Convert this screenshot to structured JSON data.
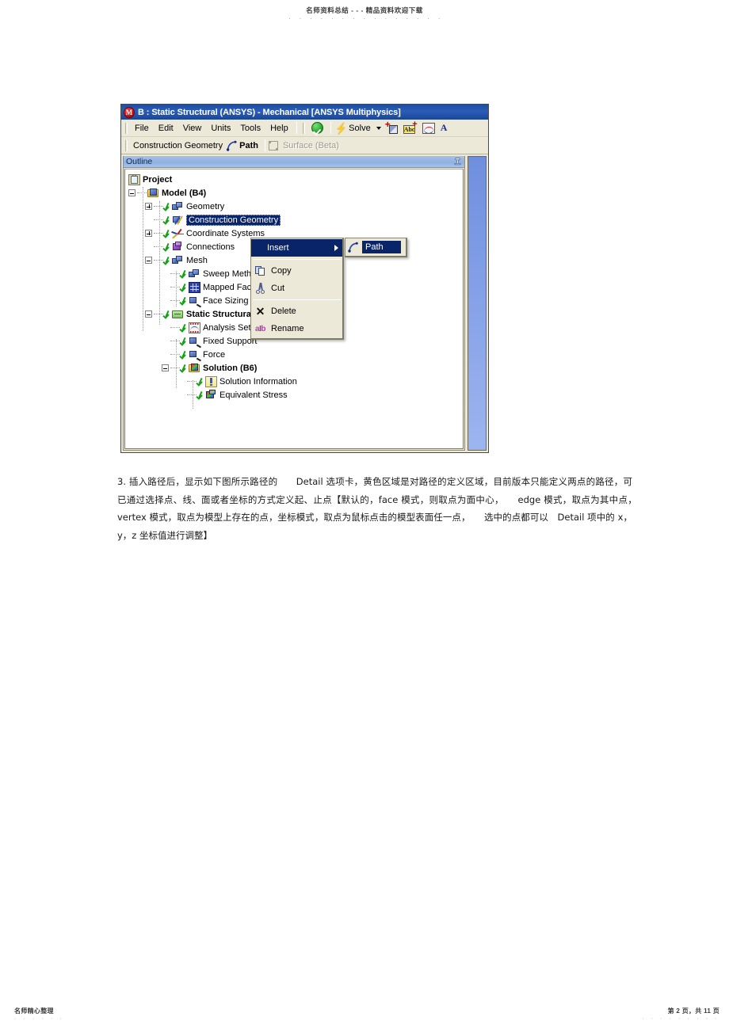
{
  "document": {
    "watermark_header": "名师资料总结 - - - 精品资料欢迎下载",
    "watermark_dots": "· · · · · · · · · · · · · · ·",
    "footer_left": "名师精心整理",
    "footer_left_dots": "· · · · · ·",
    "footer_right": "第 2 页，共 11 页",
    "footer_right_dots": "· · · · · · · · ·",
    "paragraph": "3. 插入路径后，显示如下图所示路径的　　Detail 选项卡，黄色区域是对路径的定义区域，目前版本只能定义两点的路径，可已通过选择点、线、面或者坐标的方式定义起、止点【默认的，face 模式，则取点为面中心，　　edge 模式，取点为其中点，　vertex 模式，取点为模型上存在的点，坐标模式，取点为鼠标点击的模型表面任一点，　　选中的点都可以　Detail 项中的 x，y，z 坐标值进行调整】"
  },
  "app": {
    "window_icon": "mechanical-logo-icon",
    "title": "B : Static Structural (ANSYS) - Mechanical [ANSYS Multiphysics]",
    "menus": [
      "File",
      "Edit",
      "View",
      "Units",
      "Tools",
      "Help"
    ],
    "toolbar": {
      "validate_icon": "green-check-icon",
      "solve_label": "Solve",
      "solve_icon": "lightning-bolt-icon",
      "solve_dropdown_icon": "chevron-down-icon",
      "icons": [
        "new-chart-icon",
        "new-annotation-icon",
        "new-graph-icon",
        "new-text-icon"
      ]
    },
    "toolbar2": {
      "construction_geometry_label": "Construction Geometry",
      "path_label": "Path",
      "path_icon": "path-curve-icon",
      "surface_label": "Surface (Beta)",
      "surface_icon": "surface-square-icon",
      "surface_disabled": true
    }
  },
  "outline": {
    "header_label": "Outline",
    "pin_icon": "pin-icon",
    "tree": [
      {
        "label": "Project",
        "icon": "project-icon",
        "bold": true,
        "indent": 0,
        "expander": "none",
        "check": false
      },
      {
        "label": "Model (B4)",
        "icon": "model-folder-icon",
        "bold": true,
        "indent": 1,
        "expander": "minus",
        "check": false
      },
      {
        "label": "Geometry",
        "icon": "geometry-icon",
        "bold": false,
        "indent": 2,
        "expander": "plus",
        "check": true
      },
      {
        "label": "Construction Geometry",
        "icon": "construction-geometry-icon",
        "bold": false,
        "indent": 2,
        "expander": "none",
        "check": true,
        "selected": true
      },
      {
        "label": "Coordinate Systems",
        "icon": "coordinate-systems-icon",
        "bold": false,
        "indent": 2,
        "expander": "plus",
        "check": true
      },
      {
        "label": "Connections",
        "icon": "connections-icon",
        "bold": false,
        "indent": 2,
        "expander": "none",
        "check": true
      },
      {
        "label": "Mesh",
        "icon": "mesh-icon",
        "bold": false,
        "indent": 2,
        "expander": "minus",
        "check": true
      },
      {
        "label": "Sweep Method",
        "icon": "sweep-method-icon",
        "bold": false,
        "indent": 3,
        "expander": "none",
        "check": true
      },
      {
        "label": "Mapped Face Meshing",
        "icon": "mapped-face-meshing-icon",
        "bold": false,
        "indent": 3,
        "expander": "none",
        "check": true
      },
      {
        "label": "Face Sizing",
        "icon": "face-sizing-icon",
        "bold": false,
        "indent": 3,
        "expander": "none",
        "check": true
      },
      {
        "label": "Static Structural (B5)",
        "icon": "static-structural-icon",
        "bold": true,
        "indent": 1,
        "expander": "minus",
        "check": true
      },
      {
        "label": "Analysis Settings",
        "icon": "analysis-settings-icon",
        "bold": false,
        "indent": 2,
        "expander": "none",
        "check": true
      },
      {
        "label": "Fixed Support",
        "icon": "fixed-support-icon",
        "bold": false,
        "indent": 2,
        "expander": "none",
        "check": true
      },
      {
        "label": "Force",
        "icon": "force-icon",
        "bold": false,
        "indent": 2,
        "expander": "none",
        "check": true
      },
      {
        "label": "Solution (B6)",
        "icon": "solution-icon",
        "bold": true,
        "indent": 2,
        "expander": "minus",
        "check": true
      },
      {
        "label": "Solution Information",
        "icon": "solution-information-icon",
        "bold": false,
        "indent": 3,
        "expander": "none",
        "check": true
      },
      {
        "label": "Equivalent Stress",
        "icon": "equivalent-stress-icon",
        "bold": false,
        "indent": 3,
        "expander": "none",
        "check": true
      }
    ]
  },
  "context_menu": {
    "items": [
      {
        "label": "Insert",
        "icon": "none",
        "highlighted": true,
        "submenu": true
      },
      {
        "label": "Copy",
        "icon": "copy-icon",
        "highlighted": false
      },
      {
        "label": "Cut",
        "icon": "cut-icon",
        "highlighted": false
      },
      {
        "label": "Delete",
        "icon": "delete-x-icon",
        "highlighted": false
      },
      {
        "label": "Rename",
        "icon": "rename-icon",
        "highlighted": false
      }
    ],
    "submenu": {
      "items": [
        {
          "label": "Path",
          "icon": "path-curve-icon",
          "highlighted": true
        }
      ]
    }
  },
  "colors": {
    "titlebar": "#1f4ea1",
    "menu_highlight": "#0a246a",
    "chrome": "#ece9d8",
    "outline_header": "#8fb0e0",
    "viewport": "#7f9ce6",
    "check_green": "#17a017"
  }
}
